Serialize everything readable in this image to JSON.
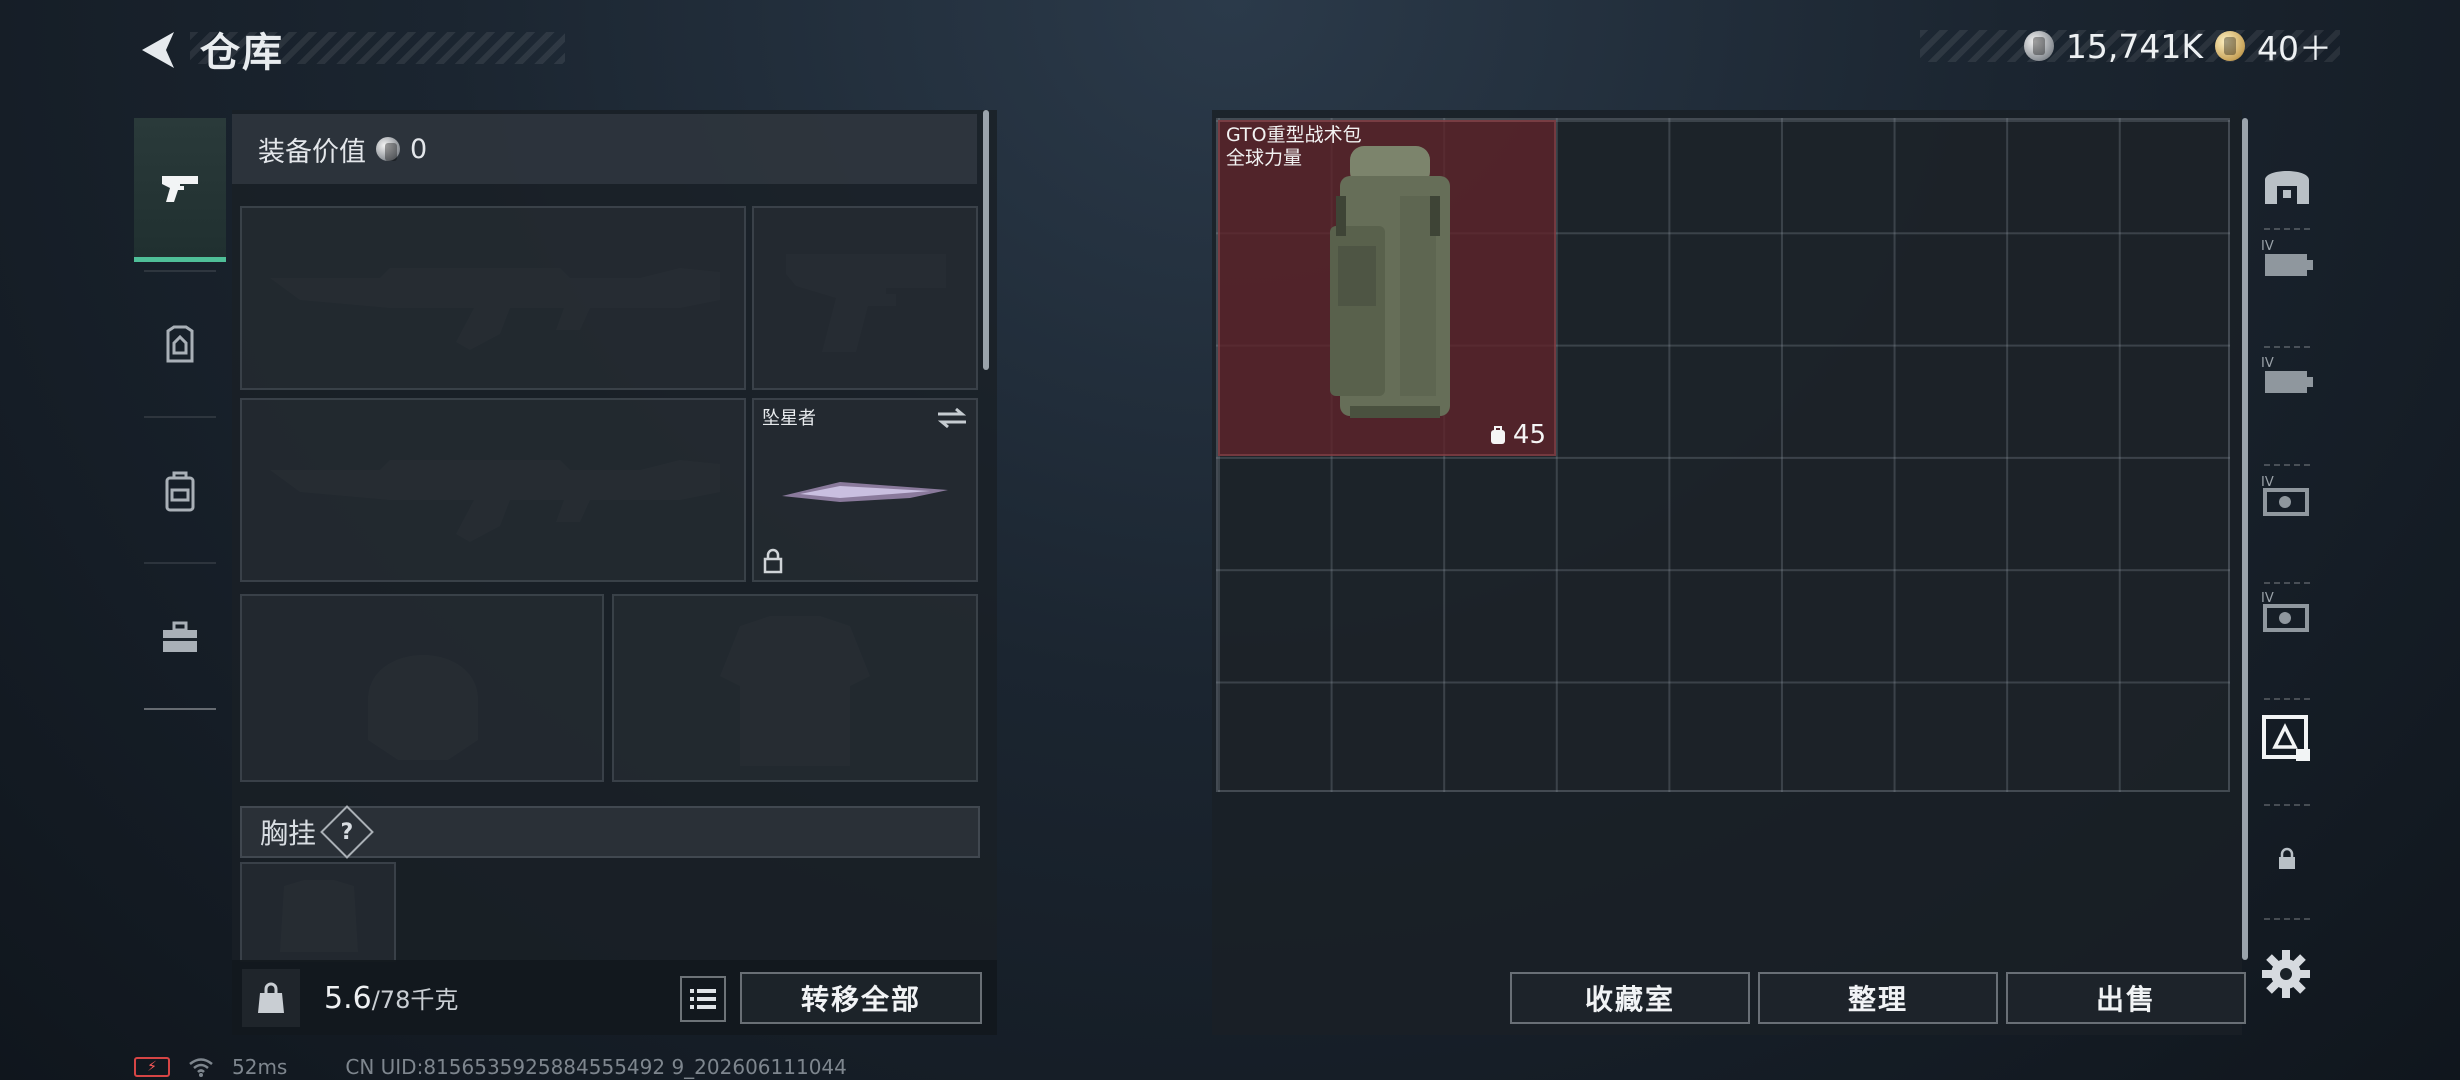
{
  "header": {
    "title": "仓库",
    "currencies": [
      {
        "icon": "silver-coin-icon",
        "value": "15,741K"
      },
      {
        "icon": "gold-coin-icon",
        "value": "40＋"
      }
    ]
  },
  "categories": [
    {
      "icon": "pistol-icon",
      "active": true
    },
    {
      "icon": "armor-icon",
      "active": false
    },
    {
      "icon": "backpack-icon",
      "active": false
    },
    {
      "icon": "toolbox-icon",
      "active": false
    }
  ],
  "equipment": {
    "value_label": "装备价值",
    "value": "0",
    "melee": {
      "name": "坠星者"
    },
    "chest_label": "胸挂",
    "help": "?"
  },
  "weight": {
    "current": "5.6",
    "max": "/78千克"
  },
  "actions": {
    "transfer_all": "转移全部",
    "collection": "收藏室",
    "organize": "整理",
    "sell": "出售"
  },
  "stash": {
    "items": [
      {
        "name_line1": "GTO重型战术包",
        "name_line2": "全球力量",
        "count": "45"
      }
    ]
  },
  "containers": [
    {
      "icon": "stash-icon",
      "tier": ""
    },
    {
      "icon": "container-icon",
      "tier": "IV"
    },
    {
      "icon": "container-icon",
      "tier": "IV"
    },
    {
      "icon": "container-icon",
      "tier": "IV"
    },
    {
      "icon": "container-icon",
      "tier": "IV"
    },
    {
      "icon": "selected-container-icon",
      "tier": ""
    },
    {
      "icon": "lock-icon",
      "tier": ""
    }
  ],
  "footer": {
    "ping": "52ms",
    "uid": "CN UID:8156535925884555492 9_202606111044"
  },
  "colors": {
    "accent": "#4fbf98",
    "item_bg": "#60242a"
  }
}
